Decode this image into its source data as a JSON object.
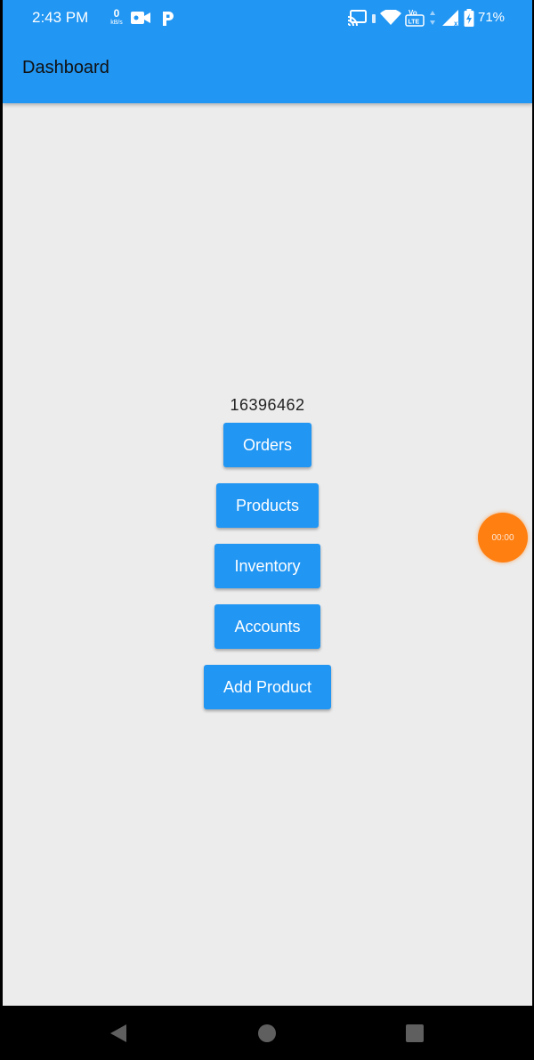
{
  "status_bar": {
    "time": "2:43 PM",
    "net_speed_value": "0",
    "net_speed_unit": "kB/s",
    "battery": "71%"
  },
  "app_bar": {
    "title": "Dashboard"
  },
  "main": {
    "counter": "16396462",
    "buttons": {
      "orders": "Orders",
      "products": "Products",
      "inventory": "Inventory",
      "accounts": "Accounts",
      "add_product": "Add Product"
    }
  },
  "floating_timer": {
    "label": "00:00"
  },
  "colors": {
    "primary": "#2196f3",
    "background": "#ececec",
    "timer": "#ff7f11"
  },
  "icons": {
    "status": [
      "video-camera-icon",
      "p-icon",
      "cast-icon",
      "vibrate-icon",
      "wifi-icon",
      "volte-icon",
      "signal-icon",
      "battery-icon"
    ],
    "nav": [
      "back-icon",
      "home-icon",
      "recents-icon"
    ]
  }
}
